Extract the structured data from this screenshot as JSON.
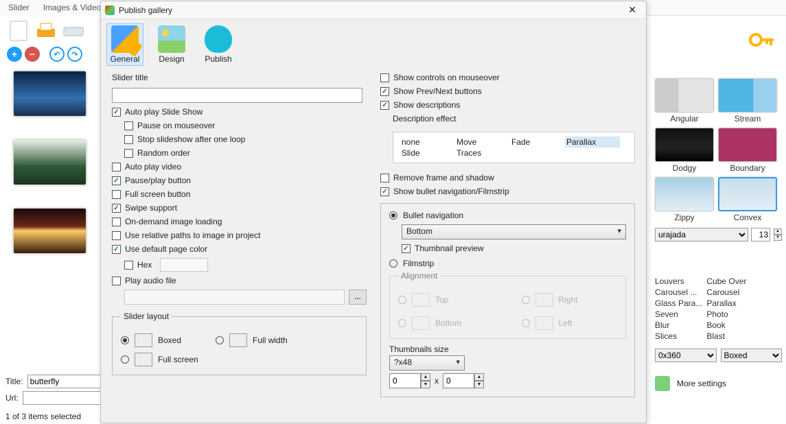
{
  "title_meta": {
    "title_label": "Title:",
    "url_label": "Url:",
    "title_value": "butterfly",
    "url_value": ""
  },
  "status": "1 of 3 items selected",
  "top_tabs": {
    "slider": "Slider",
    "images": "Images & Videos"
  },
  "right": {
    "templates": [
      {
        "name": "angular",
        "label": "Angular"
      },
      {
        "name": "stream",
        "label": "Stream"
      },
      {
        "name": "dodgy",
        "label": "Dodgy"
      },
      {
        "name": "boundary",
        "label": "Boundary"
      },
      {
        "name": "zippy",
        "label": "Zippy"
      },
      {
        "name": "convex",
        "label": "Convex"
      }
    ],
    "font": "urajada",
    "font_size": "13",
    "fx_left": [
      "Louvers",
      "Carousel ...",
      "Glass Para...",
      "Seven",
      "Blur",
      "Slices"
    ],
    "fx_right": [
      "Cube Over",
      "Carousel",
      "Parallax",
      "Photo",
      "Book",
      "Blast"
    ],
    "size": "0x360",
    "shape": "Boxed",
    "more": "More settings"
  },
  "dialog": {
    "title": "Publish gallery",
    "tabs": {
      "general": "General",
      "design": "Design",
      "publish": "Publish"
    },
    "left": {
      "slider_title_label": "Slider title",
      "slider_title_value": "",
      "autoplay_show": "Auto play Slide Show",
      "pause_mouse": "Pause on mouseover",
      "stop_loop": "Stop slideshow after one loop",
      "random": "Random order",
      "auto_video": "Auto play video",
      "pause_play": "Pause/play button",
      "fullscreen": "Full screen button",
      "swipe": "Swipe support",
      "ondemand": "On-demand image loading",
      "relpaths": "Use relative paths to image in project",
      "defcolor": "Use default page color",
      "hex": "Hex",
      "play_audio": "Play audio file",
      "layout_legend": "Slider layout",
      "boxed": "Boxed",
      "fullwidth": "Full width",
      "fullscreen_opt": "Full screen"
    },
    "right": {
      "controls_mouse": "Show controls on mouseover",
      "prev_next": "Show Prev/Next buttons",
      "descriptions": "Show descriptions",
      "desc_effect_label": "Description effect",
      "effects": [
        "none",
        "Move",
        "Fade",
        "Parallax",
        "Slide",
        "Traces"
      ],
      "selected_effect": "Parallax",
      "remove_frame": "Remove frame and shadow",
      "bullet_filmstrip": "Show bullet navigation/Filmstrip",
      "bullet_nav": "Bullet navigation",
      "bullet_pos": "Bottom",
      "thumbnail_preview": "Thumbnail preview",
      "filmstrip": "Filmstrip",
      "alignment_label": "Alignment",
      "align_top": "Top",
      "align_right": "Right",
      "align_bottom": "Bottom",
      "align_left": "Left",
      "thumbs_size_label": "Thumbnails size",
      "thumbs_size": "?x48",
      "num_a": "0",
      "num_b": "0",
      "x": "x"
    }
  }
}
